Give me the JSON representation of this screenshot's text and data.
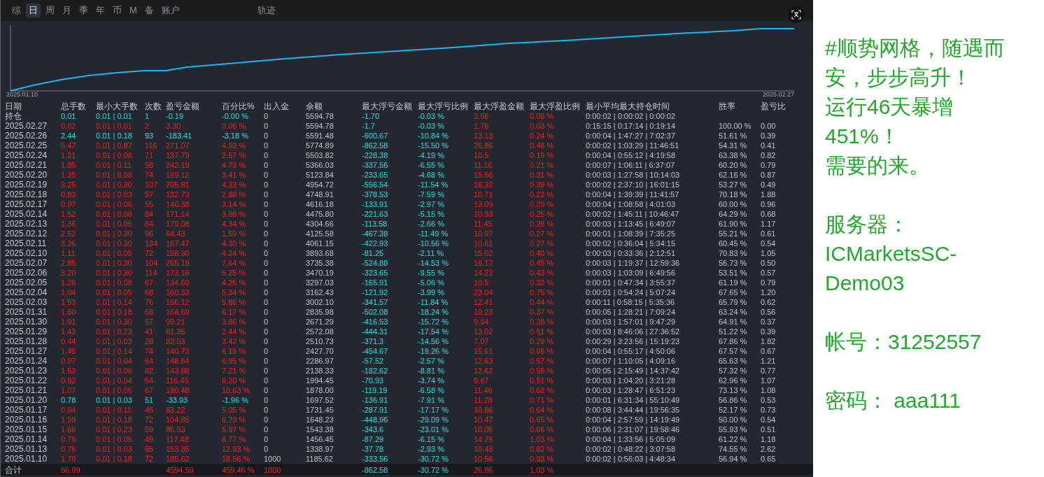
{
  "toolbar": {
    "tabs": [
      {
        "label": "综",
        "selected": false
      },
      {
        "label": "日",
        "selected": true
      },
      {
        "label": "周",
        "selected": false
      },
      {
        "label": "月",
        "selected": false
      },
      {
        "label": "季",
        "selected": false
      },
      {
        "label": "年",
        "selected": false
      },
      {
        "label": "币",
        "selected": false
      },
      {
        "label": "M",
        "selected": false
      },
      {
        "label": "备",
        "selected": false
      },
      {
        "label": "账户",
        "selected": false
      },
      {
        "label": "轨迹",
        "selected": false
      }
    ]
  },
  "chart": {
    "start_date": "2025.01.10",
    "end_date": "2025.02.27"
  },
  "table": {
    "columns": [
      "日期",
      "总手数",
      "最小大手数",
      "次数",
      "盈亏金额",
      "百分比%",
      "出入金",
      "余额",
      "最大浮亏金额",
      "最大浮亏比例",
      "最大浮盈金额",
      "最大浮盈比例",
      "最小平均最大持仓时间",
      "胜率",
      "盈亏比"
    ],
    "rows": [
      {
        "loss": true,
        "cells": [
          "持仓",
          "0.01",
          "0.01 | 0.01",
          "1",
          "-0.19",
          "-0.00 %",
          "0",
          "5594.78",
          "-1.70",
          "-0.03 %",
          "3.56",
          "0.06 %",
          "0:00:02 | 0:00:02 | 0:00:02"
        ]
      },
      {
        "loss": false,
        "cells": [
          "2025.02.27",
          "0.02",
          "0.01 | 0.01",
          "2",
          "3.30",
          "0.06 %",
          "0",
          "5594.78",
          "-1.7",
          "-0.03 %",
          "1.76",
          "0.03 %",
          "0:15:15 | 0:17:14 | 0:19:14",
          "100.00 %",
          "0.00"
        ]
      },
      {
        "loss": true,
        "cells": [
          "2025.02.26",
          "2.44",
          "0.01 | 0.18",
          "93",
          "-183.41",
          "-3.18 %",
          "0",
          "5591.48",
          "-600.67",
          "-10.84 %",
          "13.13",
          "0.24 %",
          "0:00:04 | 1:47:27 | 7:02:37",
          "51.61 %",
          "0.39"
        ]
      },
      {
        "loss": false,
        "cells": [
          "2025.02.25",
          "5.47",
          "0.01 | 0.87",
          "116",
          "271.07",
          "4.93 %",
          "0",
          "5774.89",
          "-862.58",
          "-15.50 %",
          "26.86",
          "0.48 %",
          "0:00:02 | 1:03:29 | 11:46:51",
          "54.31 %",
          "0.41"
        ]
      },
      {
        "loss": false,
        "cells": [
          "2025.02.24",
          "1.21",
          "0.01 | 0.08",
          "71",
          "137.79",
          "2.57 %",
          "0",
          "5503.82",
          "-228.38",
          "-4.19 %",
          "10.5",
          "0.19 %",
          "0:00:04 | 0:55:12 | 4:19:58",
          "63.38 %",
          "0.82"
        ]
      },
      {
        "loss": false,
        "cells": [
          "2025.02.21",
          "1.85",
          "0.01 | 0.11",
          "98",
          "242.19",
          "4.73 %",
          "0",
          "5366.03",
          "-337.56",
          "-6.55 %",
          "11.16",
          "0.21 %",
          "0:00:07 | 1:06:11 | 6:37:07",
          "60.20 %",
          "0.79"
        ]
      },
      {
        "loss": false,
        "cells": [
          "2025.02.20",
          "1.35",
          "0.01 | 0.08",
          "74",
          "169.12",
          "3.41 %",
          "0",
          "5123.84",
          "-233.65",
          "-4.68 %",
          "15.66",
          "0.31 %",
          "0:00:03 | 1:27:58 | 10:14:03",
          "62.16 %",
          "0.87"
        ]
      },
      {
        "loss": false,
        "cells": [
          "2025.02.19",
          "3.25",
          "0.01 | 0.30",
          "107",
          "205.81",
          "4.33 %",
          "0",
          "4954.72",
          "-556.54",
          "-11.54 %",
          "18.32",
          "0.39 %",
          "0:00:02 | 2:37:10 | 16:01:15",
          "53.27 %",
          "0.49"
        ]
      },
      {
        "loss": false,
        "cells": [
          "2025.02.18",
          "0.83",
          "0.01 | 0.03",
          "57",
          "132.73",
          "2.88 %",
          "0",
          "4748.91",
          "-378.53",
          "-7.59 %",
          "10.71",
          "0.23 %",
          "0:00:04 | 1:39:39 | 11:41:57",
          "70.18 %",
          "1.88"
        ]
      },
      {
        "loss": false,
        "cells": [
          "2025.02.17",
          "0.97",
          "0.01 | 0.06",
          "55",
          "140.38",
          "3.14 %",
          "0",
          "4616.18",
          "-133.91",
          "-2.97 %",
          "13.09",
          "0.29 %",
          "0:00:04 | 1:08:58 | 4:01:03",
          "60.00 %",
          "0.96"
        ]
      },
      {
        "loss": false,
        "cells": [
          "2025.02.14",
          "1.52",
          "0.01 | 0.08",
          "84",
          "171.14",
          "3.98 %",
          "0",
          "4475.80",
          "-221.63",
          "-5.15 %",
          "10.93",
          "0.25 %",
          "0:00:02 | 1:45:11 | 10:46:47",
          "64.29 %",
          "0.68"
        ]
      },
      {
        "loss": false,
        "cells": [
          "2025.02.13",
          "1.36",
          "0.01 | 0.05",
          "84",
          "179.08",
          "4.34 %",
          "0",
          "4304.66",
          "-113.58",
          "-2.66 %",
          "11.45",
          "0.28 %",
          "0:00:03 | 1:13:45 | 6:49:07",
          "61.90 %",
          "1.17"
        ]
      },
      {
        "loss": false,
        "cells": [
          "2025.02.12",
          "2.52",
          "0.01 | 0.30",
          "96",
          "64.43",
          "1.59 %",
          "0",
          "4125.58",
          "-467.38",
          "-11.49 %",
          "10.97",
          "0.27 %",
          "0:00:01 | 1:08:39 | 7:35:25",
          "55.21 %",
          "0.61"
        ]
      },
      {
        "loss": false,
        "cells": [
          "2025.02.11",
          "3.26",
          "0.01 | 0.30",
          "134",
          "167.47",
          "4.30 %",
          "0",
          "4061.15",
          "-422.93",
          "-10.56 %",
          "10.61",
          "0.27 %",
          "0:00:02 | 0:36:04 | 5:34:15",
          "60.45 %",
          "0.54"
        ]
      },
      {
        "loss": false,
        "cells": [
          "2025.02.10",
          "1.11",
          "0.01 | 0.05",
          "72",
          "158.30",
          "4.24 %",
          "0",
          "3893.68",
          "-81.25",
          "-2.11 %",
          "15.02",
          "0.40 %",
          "0:00:03 | 0:33:36 | 2:12:51",
          "70.83 %",
          "1.05"
        ]
      },
      {
        "loss": false,
        "cells": [
          "2025.02.07",
          "2.85",
          "0.01 | 0.30",
          "104",
          "265.19",
          "7.64 %",
          "0",
          "3735.38",
          "-524.88",
          "-14.53 %",
          "16.17",
          "0.45 %",
          "0:00:03 | 1:19:37 | 12:59:36",
          "56.73 %",
          "0.50"
        ]
      },
      {
        "loss": false,
        "cells": [
          "2025.02.06",
          "3.20",
          "0.01 | 0.30",
          "114",
          "173.16",
          "5.25 %",
          "0",
          "3470.19",
          "-323.65",
          "-9.55 %",
          "14.22",
          "0.43 %",
          "0:00:03 | 1:03:09 | 6:49:56",
          "53.51 %",
          "0.57"
        ]
      },
      {
        "loss": false,
        "cells": [
          "2025.02.05",
          "1.26",
          "0.01 | 0.08",
          "67",
          "134.60",
          "4.26 %",
          "0",
          "3297.03",
          "-165.91",
          "-5.06 %",
          "10.5",
          "0.32 %",
          "0:00:01 | 0:47:34 | 3:55:37",
          "61.19 %",
          "0.79"
        ]
      },
      {
        "loss": false,
        "cells": [
          "2025.02.04",
          "1.04",
          "0.01 | 0.05",
          "68",
          "160.33",
          "5.34 %",
          "0",
          "3162.43",
          "-121.92",
          "-3.99 %",
          "23.04",
          "0.75 %",
          "0:00:01 | 0:54:24 | 5:07:24",
          "67.65 %",
          "1.20"
        ]
      },
      {
        "loss": false,
        "cells": [
          "2025.02.03",
          "1.53",
          "0.01 | 0.14",
          "76",
          "166.12",
          "5.86 %",
          "0",
          "3002.10",
          "-341.57",
          "-11.84 %",
          "12.41",
          "0.44 %",
          "0:00:11 | 0:58:15 | 5:35:36",
          "65.79 %",
          "0.62"
        ]
      },
      {
        "loss": false,
        "cells": [
          "2025.01.31",
          "1.60",
          "0.01 | 0.18",
          "68",
          "164.69",
          "6.17 %",
          "0",
          "2835.98",
          "-502.08",
          "-18.24 %",
          "10.23",
          "0.37 %",
          "0:00:05 | 1:28:21 | 7:09:24",
          "63.24 %",
          "0.56"
        ]
      },
      {
        "loss": false,
        "cells": [
          "2025.01.30",
          "1.91",
          "0.01 | 0.30",
          "57",
          "99.21",
          "3.86 %",
          "0",
          "2671.29",
          "-416.53",
          "-15.72 %",
          "9.94",
          "0.38 %",
          "0:00:03 | 1:57:01 | 9:47:29",
          "64.91 %",
          "0.37"
        ]
      },
      {
        "loss": false,
        "cells": [
          "2025.01.29",
          "1.43",
          "0.01 | 0.23",
          "41",
          "61.35",
          "2.44 %",
          "0",
          "2572.08",
          "-444.31",
          "-17.54 %",
          "13.02",
          "0.51 %",
          "0:00:03 | 8:46:06 | 27:36:52",
          "51.22 %",
          "0.39"
        ]
      },
      {
        "loss": false,
        "cells": [
          "2025.01.28",
          "0.44",
          "0.01 | 0.03",
          "28",
          "83.03",
          "3.42 %",
          "0",
          "2510.73",
          "-371.3",
          "-14.56 %",
          "7.07",
          "0.29 %",
          "0:00:29 | 3:23:56 | 15:19:23",
          "67.86 %",
          "1.82"
        ]
      },
      {
        "loss": false,
        "cells": [
          "2025.01.27",
          "1.45",
          "0.01 | 0.14",
          "74",
          "140.73",
          "6.15 %",
          "0",
          "2427.70",
          "-454.67",
          "-19.26 %",
          "15.61",
          "0.66 %",
          "0:00:04 | 0:55:17 | 4:50:06",
          "67.57 %",
          "0.67"
        ]
      },
      {
        "loss": false,
        "cells": [
          "2025.01.24",
          "0.97",
          "0.01 | 0.04",
          "64",
          "148.64",
          "6.95 %",
          "0",
          "2286.97",
          "-57.52",
          "-2.57 %",
          "12.63",
          "0.57 %",
          "0:00:07 | 1:10:05 | 4:09:16",
          "65.63 %",
          "1.21"
        ]
      },
      {
        "loss": false,
        "cells": [
          "2025.01.23",
          "1.53",
          "0.01 | 0.06",
          "82",
          "143.88",
          "7.21 %",
          "0",
          "2138.33",
          "-182.62",
          "-8.81 %",
          "12.62",
          "0.59 %",
          "0:00:05 | 2:15:49 | 14:37:42",
          "57.32 %",
          "0.77"
        ]
      },
      {
        "loss": false,
        "cells": [
          "2025.01.22",
          "0.92",
          "0.01 | 0.04",
          "54",
          "116.45",
          "6.20 %",
          "0",
          "1994.45",
          "-70.93",
          "-3.74 %",
          "9.67",
          "0.51 %",
          "0:00:03 | 1:04:20 | 3:21:28",
          "62.96 %",
          "1.07"
        ]
      },
      {
        "loss": false,
        "cells": [
          "2025.01.21",
          "1.07",
          "0.01 | 0.06",
          "67",
          "180.48",
          "10.63 %",
          "0",
          "1878.00",
          "-119.19",
          "-6.58 %",
          "11.46",
          "0.62 %",
          "0:00:03 | 1:28:47 | 6:51:23",
          "73.13 %",
          "1.08"
        ]
      },
      {
        "loss": true,
        "cells": [
          "2025.01.20",
          "0.78",
          "0.01 | 0.03",
          "51",
          "-33.93",
          "-1.96 %",
          "0",
          "1697.52",
          "-136.91",
          "-7.91 %",
          "11.28",
          "0.71 %",
          "0:00:01 | 6:31:34 | 55:10:49",
          "56.86 %",
          "0.53"
        ]
      },
      {
        "loss": false,
        "cells": [
          "2025.01.17",
          "0.94",
          "0.01 | 0.11",
          "46",
          "83.22",
          "5.05 %",
          "0",
          "1731.45",
          "-287.91",
          "-17.17 %",
          "10.86",
          "0.64 %",
          "0:00:08 | 3:44:44 | 19:56:35",
          "52.17 %",
          "0.73"
        ]
      },
      {
        "loss": false,
        "cells": [
          "2025.01.16",
          "1.99",
          "0.01 | 0.18",
          "72",
          "104.85",
          "6.79 %",
          "0",
          "1648.23",
          "-448.96",
          "-29.09 %",
          "10.47",
          "0.65 %",
          "0:00:04 | 2:57:59 | 14:19:49",
          "50.00 %",
          "0.54"
        ]
      },
      {
        "loss": false,
        "cells": [
          "2025.01.15",
          "1.66",
          "0.01 | 0.23",
          "59",
          "86.93",
          "5.97 %",
          "0",
          "1543.38",
          "-343.6",
          "-23.01 %",
          "10.05",
          "0.66 %",
          "0:00:06 | 2:31:07 | 19:58:46",
          "55.93 %",
          "0.51"
        ]
      },
      {
        "loss": false,
        "cells": [
          "2025.01.14",
          "0.79",
          "0.01 | 0.05",
          "49",
          "117.48",
          "8.77 %",
          "0",
          "1456.45",
          "-87.29",
          "-6.15 %",
          "14.26",
          "1.03 %",
          "0:00:04 | 1:33:56 | 5:05:09",
          "61.22 %",
          "1.18"
        ]
      },
      {
        "loss": false,
        "cells": [
          "2025.01.13",
          "0.76",
          "0.01 | 0.03",
          "55",
          "153.35",
          "12.93 %",
          "0",
          "1338.97",
          "-37.78",
          "-2.93 %",
          "10.48",
          "0.82 %",
          "0:00:02 | 0:48:22 | 3:07:58",
          "74.55 %",
          "2.62"
        ]
      },
      {
        "loss": false,
        "cells": [
          "2025.01.10",
          "1.70",
          "0.01 | 0.18",
          "72",
          "185.62",
          "18.56 %",
          "1000",
          "1185.62",
          "-333.56",
          "-30.72 %",
          "10.56",
          "0.93 %",
          "0:00:02 | 0:56:03 | 4:48:34",
          "56.94 %",
          "0.65"
        ]
      }
    ],
    "summary": {
      "loss": false,
      "label": "合计",
      "total_lots": "56.99",
      "pnl": "4594.59",
      "pct": "459.46 %",
      "in_out": "1000",
      "max_float_loss": "-862.58",
      "max_float_loss_pct": "-30.72 %",
      "max_float_profit": "26.86",
      "max_float_profit_pct": "1.03 %"
    }
  },
  "note": {
    "paragraphs": [
      [
        "#顺势网格，随遇而安，步步高升！",
        "运行46天暴增451%！",
        "需要的来。"
      ],
      [
        "服务器：ICMarketsSC-Demo03"
      ],
      [
        "帐号：31252557"
      ],
      [
        "密码： aaa111"
      ]
    ]
  }
}
